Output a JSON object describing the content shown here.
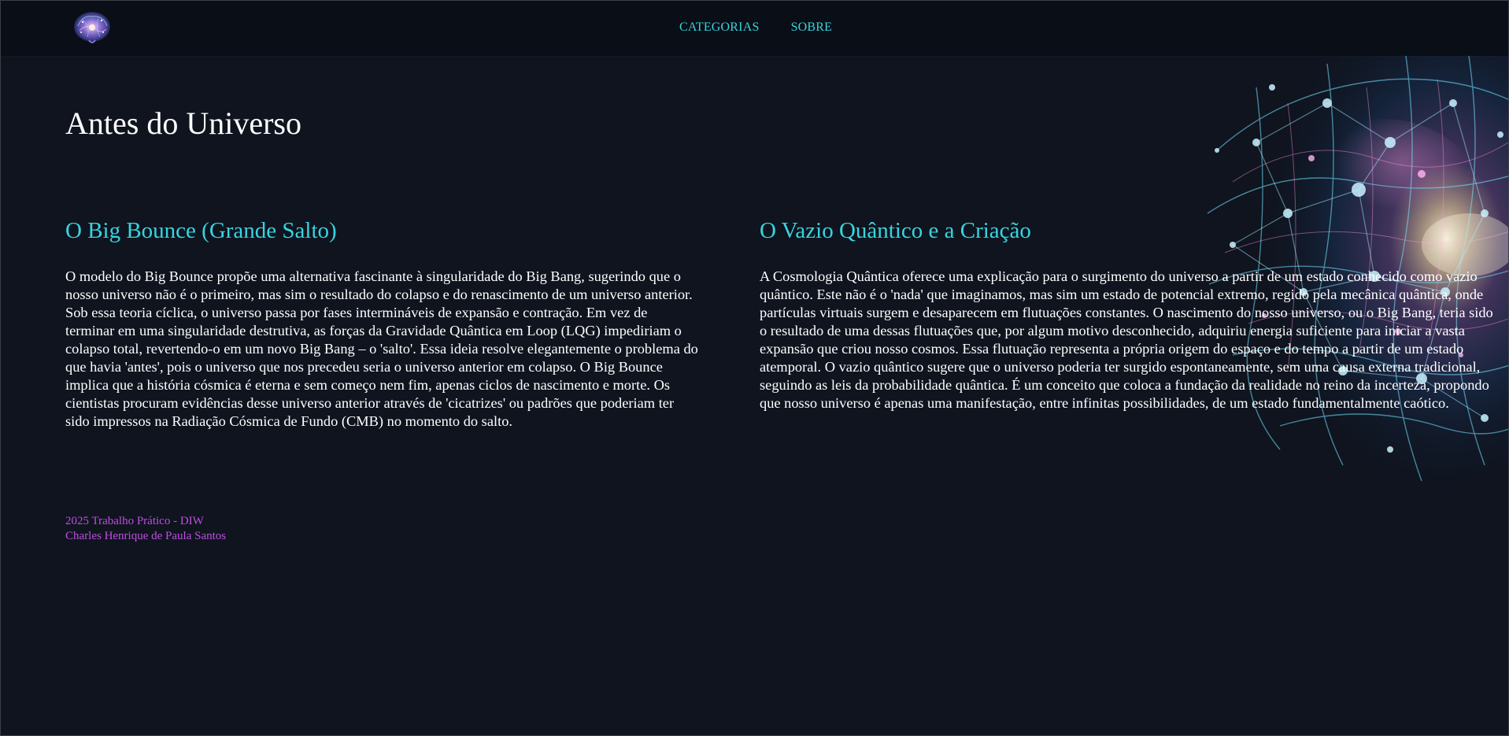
{
  "header": {
    "logo_icon": "brain-galaxy-icon",
    "nav": [
      {
        "label": "CATEGORIAS"
      },
      {
        "label": "SOBRE"
      }
    ]
  },
  "main": {
    "title": "Antes do Universo",
    "sections": [
      {
        "heading": "O Big Bounce (Grande Salto)",
        "body": "O modelo do Big Bounce propõe uma alternativa fascinante à singularidade do Big Bang, sugerindo que o nosso universo não é o primeiro, mas sim o resultado do colapso e do renascimento de um universo anterior. Sob essa teoria cíclica, o universo passa por fases intermináveis de expansão e contração. Em vez de terminar em uma singularidade destrutiva, as forças da Gravidade Quântica em Loop (LQG) impediriam o colapso total, revertendo-o em um novo Big Bang – o 'salto'. Essa ideia resolve elegantemente o problema do que havia 'antes', pois o universo que nos precedeu seria o universo anterior em colapso. O Big Bounce implica que a história cósmica é eterna e sem começo nem fim, apenas ciclos de nascimento e morte. Os cientistas procuram evidências desse universo anterior através de 'cicatrizes' ou padrões que poderiam ter sido impressos na Radiação Cósmica de Fundo (CMB) no momento do salto."
      },
      {
        "heading": "O Vazio Quântico e a Criação",
        "body": "A Cosmologia Quântica oferece uma explicação para o surgimento do universo a partir de um estado conhecido como vazio quântico. Este não é o 'nada' que imaginamos, mas sim um estado de potencial extremo, regido pela mecânica quântica, onde partículas virtuais surgem e desaparecem em flutuações constantes. O nascimento do nosso universo, ou o Big Bang, teria sido o resultado de uma dessas flutuações que, por algum motivo desconhecido, adquiriu energia suficiente para iniciar a vasta expansão que criou nosso cosmos. Essa flutuação representa a própria origem do espaço e do tempo a partir de um estado atemporal. O vazio quântico sugere que o universo poderia ter surgido espontaneamente, sem uma causa externa tradicional, seguindo as leis da probabilidade quântica. É um conceito que coloca a fundação da realidade no reino da incerteza, propondo que nosso universo é apenas uma manifestação, entre infinitas possibilidades, de um estado fundamentalmente caótico."
      }
    ]
  },
  "footer": {
    "line1": "2025 Trabalho Prático - DIW",
    "line2": "Charles Henrique de Paula Santos"
  },
  "colors": {
    "background": "#0f141f",
    "header_bg": "#0a0e16",
    "accent_cyan": "#38d4de",
    "footer_magenta": "#c04ee0",
    "text": "#ffffff"
  },
  "decor": {
    "background_art": "brain-network-galaxy-image"
  }
}
